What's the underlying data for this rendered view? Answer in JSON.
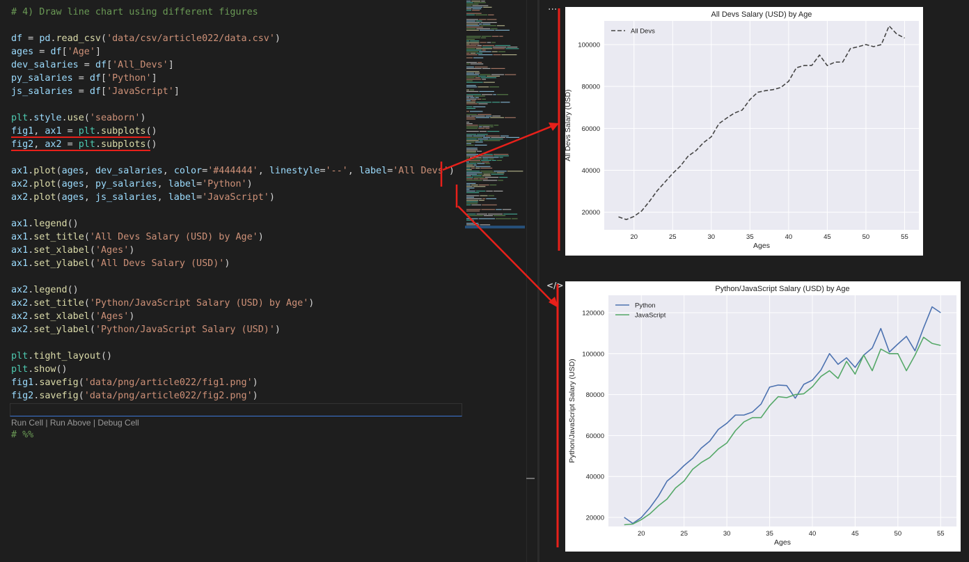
{
  "editor": {
    "lines": [
      [
        {
          "t": "# 4) Draw line chart using different figures",
          "c": "cmt"
        }
      ],
      [],
      [
        {
          "t": "df",
          "c": "var"
        },
        {
          "t": " = ",
          "c": "kw"
        },
        {
          "t": "pd",
          "c": "var"
        },
        {
          "t": ".",
          "c": "kw"
        },
        {
          "t": "read_csv",
          "c": "fn"
        },
        {
          "t": "(",
          "c": "kw"
        },
        {
          "t": "'data/csv/article022/data.csv'",
          "c": "str"
        },
        {
          "t": ")",
          "c": "kw"
        }
      ],
      [
        {
          "t": "ages",
          "c": "var"
        },
        {
          "t": " = ",
          "c": "kw"
        },
        {
          "t": "df",
          "c": "var"
        },
        {
          "t": "[",
          "c": "kw"
        },
        {
          "t": "'Age'",
          "c": "str"
        },
        {
          "t": "]",
          "c": "kw"
        }
      ],
      [
        {
          "t": "dev_salaries",
          "c": "var"
        },
        {
          "t": " = ",
          "c": "kw"
        },
        {
          "t": "df",
          "c": "var"
        },
        {
          "t": "[",
          "c": "kw"
        },
        {
          "t": "'All_Devs'",
          "c": "str"
        },
        {
          "t": "]",
          "c": "kw"
        }
      ],
      [
        {
          "t": "py_salaries",
          "c": "var"
        },
        {
          "t": " = ",
          "c": "kw"
        },
        {
          "t": "df",
          "c": "var"
        },
        {
          "t": "[",
          "c": "kw"
        },
        {
          "t": "'Python'",
          "c": "str"
        },
        {
          "t": "]",
          "c": "kw"
        }
      ],
      [
        {
          "t": "js_salaries",
          "c": "var"
        },
        {
          "t": " = ",
          "c": "kw"
        },
        {
          "t": "df",
          "c": "var"
        },
        {
          "t": "[",
          "c": "kw"
        },
        {
          "t": "'JavaScript'",
          "c": "str"
        },
        {
          "t": "]",
          "c": "kw"
        }
      ],
      [],
      [
        {
          "t": "plt",
          "c": "obj"
        },
        {
          "t": ".",
          "c": "kw"
        },
        {
          "t": "style",
          "c": "var"
        },
        {
          "t": ".",
          "c": "kw"
        },
        {
          "t": "use",
          "c": "fn"
        },
        {
          "t": "(",
          "c": "kw"
        },
        {
          "t": "'seaborn'",
          "c": "str"
        },
        {
          "t": ")",
          "c": "kw"
        }
      ],
      [
        {
          "t": "fig1",
          "c": "var"
        },
        {
          "t": ", ",
          "c": "kw"
        },
        {
          "t": "ax1",
          "c": "var"
        },
        {
          "t": " = ",
          "c": "kw"
        },
        {
          "t": "plt",
          "c": "obj"
        },
        {
          "t": ".",
          "c": "kw"
        },
        {
          "t": "subplots",
          "c": "fn"
        },
        {
          "t": "()",
          "c": "kw"
        }
      ],
      [
        {
          "t": "fig2",
          "c": "var"
        },
        {
          "t": ", ",
          "c": "kw"
        },
        {
          "t": "ax2",
          "c": "var"
        },
        {
          "t": " = ",
          "c": "kw"
        },
        {
          "t": "plt",
          "c": "obj"
        },
        {
          "t": ".",
          "c": "kw"
        },
        {
          "t": "subplots",
          "c": "fn"
        },
        {
          "t": "()",
          "c": "kw"
        }
      ],
      [],
      [
        {
          "t": "ax1",
          "c": "var"
        },
        {
          "t": ".",
          "c": "kw"
        },
        {
          "t": "plot",
          "c": "fn"
        },
        {
          "t": "(",
          "c": "kw"
        },
        {
          "t": "ages",
          "c": "var"
        },
        {
          "t": ", ",
          "c": "kw"
        },
        {
          "t": "dev_salaries",
          "c": "var"
        },
        {
          "t": ", ",
          "c": "kw"
        },
        {
          "t": "color",
          "c": "var"
        },
        {
          "t": "=",
          "c": "kw"
        },
        {
          "t": "'#444444'",
          "c": "str"
        },
        {
          "t": ", ",
          "c": "kw"
        },
        {
          "t": "linestyle",
          "c": "var"
        },
        {
          "t": "=",
          "c": "kw"
        },
        {
          "t": "'--'",
          "c": "str"
        },
        {
          "t": ", ",
          "c": "kw"
        },
        {
          "t": "label",
          "c": "var"
        },
        {
          "t": "=",
          "c": "kw"
        },
        {
          "t": "'All Devs'",
          "c": "str"
        },
        {
          "t": ")",
          "c": "kw"
        }
      ],
      [
        {
          "t": "ax2",
          "c": "var"
        },
        {
          "t": ".",
          "c": "kw"
        },
        {
          "t": "plot",
          "c": "fn"
        },
        {
          "t": "(",
          "c": "kw"
        },
        {
          "t": "ages",
          "c": "var"
        },
        {
          "t": ", ",
          "c": "kw"
        },
        {
          "t": "py_salaries",
          "c": "var"
        },
        {
          "t": ", ",
          "c": "kw"
        },
        {
          "t": "label",
          "c": "var"
        },
        {
          "t": "=",
          "c": "kw"
        },
        {
          "t": "'Python'",
          "c": "str"
        },
        {
          "t": ")",
          "c": "kw"
        }
      ],
      [
        {
          "t": "ax2",
          "c": "var"
        },
        {
          "t": ".",
          "c": "kw"
        },
        {
          "t": "plot",
          "c": "fn"
        },
        {
          "t": "(",
          "c": "kw"
        },
        {
          "t": "ages",
          "c": "var"
        },
        {
          "t": ", ",
          "c": "kw"
        },
        {
          "t": "js_salaries",
          "c": "var"
        },
        {
          "t": ", ",
          "c": "kw"
        },
        {
          "t": "label",
          "c": "var"
        },
        {
          "t": "=",
          "c": "kw"
        },
        {
          "t": "'JavaScript'",
          "c": "str"
        },
        {
          "t": ")",
          "c": "kw"
        }
      ],
      [],
      [
        {
          "t": "ax1",
          "c": "var"
        },
        {
          "t": ".",
          "c": "kw"
        },
        {
          "t": "legend",
          "c": "fn"
        },
        {
          "t": "()",
          "c": "kw"
        }
      ],
      [
        {
          "t": "ax1",
          "c": "var"
        },
        {
          "t": ".",
          "c": "kw"
        },
        {
          "t": "set_title",
          "c": "fn"
        },
        {
          "t": "(",
          "c": "kw"
        },
        {
          "t": "'All Devs Salary (USD) by Age'",
          "c": "str"
        },
        {
          "t": ")",
          "c": "kw"
        }
      ],
      [
        {
          "t": "ax1",
          "c": "var"
        },
        {
          "t": ".",
          "c": "kw"
        },
        {
          "t": "set_xlabel",
          "c": "fn"
        },
        {
          "t": "(",
          "c": "kw"
        },
        {
          "t": "'Ages'",
          "c": "str"
        },
        {
          "t": ")",
          "c": "kw"
        }
      ],
      [
        {
          "t": "ax1",
          "c": "var"
        },
        {
          "t": ".",
          "c": "kw"
        },
        {
          "t": "set_ylabel",
          "c": "fn"
        },
        {
          "t": "(",
          "c": "kw"
        },
        {
          "t": "'All Devs Salary (USD)'",
          "c": "str"
        },
        {
          "t": ")",
          "c": "kw"
        }
      ],
      [],
      [
        {
          "t": "ax2",
          "c": "var"
        },
        {
          "t": ".",
          "c": "kw"
        },
        {
          "t": "legend",
          "c": "fn"
        },
        {
          "t": "()",
          "c": "kw"
        }
      ],
      [
        {
          "t": "ax2",
          "c": "var"
        },
        {
          "t": ".",
          "c": "kw"
        },
        {
          "t": "set_title",
          "c": "fn"
        },
        {
          "t": "(",
          "c": "kw"
        },
        {
          "t": "'Python/JavaScript Salary (USD) by Age'",
          "c": "str"
        },
        {
          "t": ")",
          "c": "kw"
        }
      ],
      [
        {
          "t": "ax2",
          "c": "var"
        },
        {
          "t": ".",
          "c": "kw"
        },
        {
          "t": "set_xlabel",
          "c": "fn"
        },
        {
          "t": "(",
          "c": "kw"
        },
        {
          "t": "'Ages'",
          "c": "str"
        },
        {
          "t": ")",
          "c": "kw"
        }
      ],
      [
        {
          "t": "ax2",
          "c": "var"
        },
        {
          "t": ".",
          "c": "kw"
        },
        {
          "t": "set_ylabel",
          "c": "fn"
        },
        {
          "t": "(",
          "c": "kw"
        },
        {
          "t": "'Python/JavaScript Salary (USD)'",
          "c": "str"
        },
        {
          "t": ")",
          "c": "kw"
        }
      ],
      [],
      [
        {
          "t": "plt",
          "c": "obj"
        },
        {
          "t": ".",
          "c": "kw"
        },
        {
          "t": "tight_layout",
          "c": "fn"
        },
        {
          "t": "()",
          "c": "kw"
        }
      ],
      [
        {
          "t": "plt",
          "c": "obj"
        },
        {
          "t": ".",
          "c": "kw"
        },
        {
          "t": "show",
          "c": "fn"
        },
        {
          "t": "()",
          "c": "kw"
        }
      ],
      [
        {
          "t": "fig1",
          "c": "var"
        },
        {
          "t": ".",
          "c": "kw"
        },
        {
          "t": "savefig",
          "c": "fn"
        },
        {
          "t": "(",
          "c": "kw"
        },
        {
          "t": "'data/png/article022/fig1.png'",
          "c": "str"
        },
        {
          "t": ")",
          "c": "kw"
        }
      ],
      [
        {
          "t": "fig2",
          "c": "var"
        },
        {
          "t": ".",
          "c": "kw"
        },
        {
          "t": "savefig",
          "c": "fn"
        },
        {
          "t": "(",
          "c": "kw"
        },
        {
          "t": "'data/png/article022/fig2.png'",
          "c": "str"
        },
        {
          "t": ")",
          "c": "kw"
        }
      ]
    ],
    "codelens": {
      "run_cell": "Run Cell",
      "run_above": "Run Above",
      "debug_cell": "Debug Cell",
      "sep": " | "
    },
    "cell_marker": "# %%"
  },
  "output": {
    "more_icon": "···",
    "code_icon": "</>"
  },
  "colors": {
    "annotation": "#e8201a",
    "python": "#4c72b0",
    "javascript": "#55a868",
    "alldevs": "#444444",
    "axes_bg": "#eaeaf2"
  },
  "chart_data": [
    {
      "type": "line",
      "title": "All Devs Salary (USD) by Age",
      "xlabel": "Ages",
      "ylabel": "All Devs Salary (USD)",
      "xlim": [
        16.15,
        56.85
      ],
      "ylim": [
        11600,
        111300
      ],
      "xticks": [
        20,
        25,
        30,
        35,
        40,
        45,
        50,
        55
      ],
      "yticks": [
        20000,
        40000,
        60000,
        80000,
        100000
      ],
      "legend": "top-left",
      "x": [
        18,
        19,
        20,
        21,
        22,
        23,
        24,
        25,
        26,
        27,
        28,
        29,
        30,
        31,
        32,
        33,
        34,
        35,
        36,
        37,
        38,
        39,
        40,
        41,
        42,
        43,
        44,
        45,
        46,
        47,
        48,
        49,
        50,
        51,
        52,
        53,
        54,
        55
      ],
      "series": [
        {
          "name": "All Devs",
          "style": "dashed",
          "color": "#444444",
          "values": [
            17784,
            16500,
            18012,
            20628,
            25206,
            30252,
            34368,
            38496,
            42000,
            46752,
            49320,
            53200,
            56000,
            62316,
            64928,
            67317,
            68748,
            73752,
            77232,
            78000,
            78508,
            79536,
            82488,
            88935,
            90000,
            90056,
            95000,
            90000,
            91633,
            91660,
            98150,
            98964,
            100000,
            98988,
            100000,
            108923,
            105000,
            103117
          ]
        }
      ]
    },
    {
      "type": "line",
      "title": "Python/JavaScript Salary (USD) by Age",
      "xlabel": "Ages",
      "ylabel": "Python/JavaScript Salary (USD)",
      "xlim": [
        16.15,
        56.85
      ],
      "ylim": [
        15600,
        128500
      ],
      "xticks": [
        20,
        25,
        30,
        35,
        40,
        45,
        50,
        55
      ],
      "yticks": [
        20000,
        40000,
        60000,
        80000,
        100000,
        120000
      ],
      "legend": "top-left",
      "x": [
        18,
        19,
        20,
        21,
        22,
        23,
        24,
        25,
        26,
        27,
        28,
        29,
        30,
        31,
        32,
        33,
        34,
        35,
        36,
        37,
        38,
        39,
        40,
        41,
        42,
        43,
        44,
        45,
        46,
        47,
        48,
        49,
        50,
        51,
        52,
        53,
        54,
        55
      ],
      "series": [
        {
          "name": "Python",
          "color": "#4c72b0",
          "values": [
            20046,
            17100,
            20000,
            24744,
            30500,
            37732,
            41247,
            45372,
            48876,
            53850,
            57287,
            63016,
            65998,
            70003,
            70000,
            71496,
            75370,
            83640,
            84666,
            84392,
            78254,
            85000,
            87038,
            91991,
            100000,
            94796,
            97962,
            93302,
            99240,
            102736,
            112285,
            100771,
            104708,
            108423,
            101407,
            112542,
            122870,
            120000
          ]
        },
        {
          "name": "JavaScript",
          "color": "#55a868",
          "values": [
            16446,
            16791,
            18942,
            21780,
            25704,
            29000,
            34372,
            37810,
            43515,
            46823,
            49293,
            53437,
            56373,
            62375,
            66674,
            68745,
            68746,
            74583,
            79000,
            78508,
            79996,
            80403,
            83820,
            88833,
            91660,
            87892,
            96243,
            90000,
            99313,
            91660,
            102264,
            100000,
            100000,
            91660,
            99240,
            108000,
            105000,
            104000
          ]
        }
      ]
    }
  ]
}
